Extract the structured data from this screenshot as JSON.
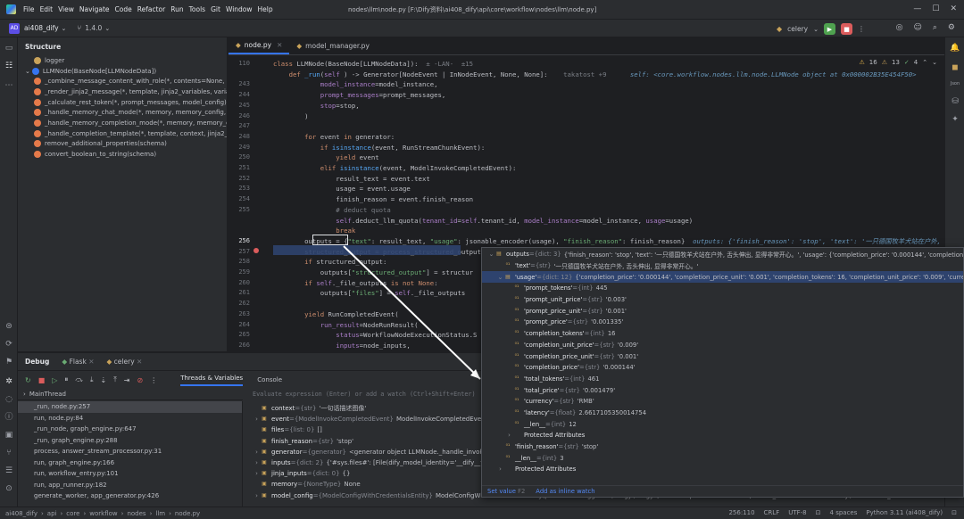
{
  "titlebar": {
    "menu": [
      "File",
      "Edit",
      "View",
      "Navigate",
      "Code",
      "Refactor",
      "Run",
      "Tools",
      "Git",
      "Window",
      "Help"
    ],
    "path": "nodes\\llm\\node.py [F:\\Dify资料\\ai408_dify\\api\\core\\workflow\\nodes\\llm\\node.py]"
  },
  "toolbar": {
    "project_badge": "AD",
    "project": "ai408_dify",
    "branch": "1.4.0",
    "run_config": "celery"
  },
  "structure": {
    "title": "Structure",
    "items": [
      {
        "label": "logger",
        "color": "#c9a35a",
        "indent": 1
      },
      {
        "label": "LLMNode(BaseNode[LLMNodeData])",
        "color": "#3574f0",
        "indent": 0
      },
      {
        "label": "_combine_message_content_with_role(*, contents=None, role)",
        "color": "#e57a4a",
        "indent": 1
      },
      {
        "label": "_render_jinja2_message(*, template, jinja2_variables, variable_pool)",
        "color": "#e57a4a",
        "indent": 1
      },
      {
        "label": "_calculate_rest_token(*, prompt_messages, model_config)",
        "color": "#e57a4a",
        "indent": 1
      },
      {
        "label": "_handle_memory_chat_mode(*, memory, memory_config, model_con",
        "color": "#e57a4a",
        "indent": 1
      },
      {
        "label": "_handle_memory_completion_mode(*, memory, memory_config, mo",
        "color": "#e57a4a",
        "indent": 1
      },
      {
        "label": "_handle_completion_template(*, template, context, jinja2_variables, v",
        "color": "#e57a4a",
        "indent": 1
      },
      {
        "label": "remove_additional_properties(schema)",
        "color": "#e57a4a",
        "indent": 1
      },
      {
        "label": "convert_boolean_to_string(schema)",
        "color": "#e57a4a",
        "indent": 1
      }
    ]
  },
  "editor": {
    "tabs": [
      "node.py",
      "model_manager.py"
    ],
    "inspection": {
      "warnings": "16",
      "weak": "13",
      "typos": "4"
    },
    "lines": [
      {
        "n": "110",
        "parts": [
          [
            "kw",
            "class "
          ],
          [
            "",
            "LLMNode(BaseNode[LLMNodeData]):  "
          ],
          [
            "cm",
            "± -LAN-  ±15"
          ]
        ]
      },
      {
        "n": "",
        "parts": [
          [
            "kw",
            "    def "
          ],
          [
            "fn",
            "_run"
          ],
          [
            "",
            "("
          ],
          [
            "param",
            "self"
          ],
          [
            "",
            " ) -> Generator["
          ],
          [
            "",
            "NodeEvent | InNodeEvent, None, None]:  "
          ],
          [
            "cm",
            "  takatost +9      "
          ],
          [
            "dbg",
            "self: <core.workflow.nodes.llm.node.LLMNode object at 0x000002B35E454F50>"
          ]
        ]
      },
      {
        "n": "243",
        "parts": [
          [
            "",
            "            "
          ],
          [
            "param",
            "model_instance"
          ],
          [
            "",
            "=model_instance,"
          ]
        ]
      },
      {
        "n": "244",
        "parts": [
          [
            "",
            "            "
          ],
          [
            "param",
            "prompt_messages"
          ],
          [
            "",
            "=prompt_messages,"
          ]
        ]
      },
      {
        "n": "245",
        "parts": [
          [
            "",
            "            "
          ],
          [
            "param",
            "stop"
          ],
          [
            "",
            "=stop,"
          ]
        ]
      },
      {
        "n": "246",
        "parts": [
          [
            "",
            "        )"
          ]
        ]
      },
      {
        "n": "247",
        "parts": [
          [
            "",
            ""
          ]
        ]
      },
      {
        "n": "248",
        "parts": [
          [
            "kw",
            "        for "
          ],
          [
            "",
            "event "
          ],
          [
            "kw",
            "in "
          ],
          [
            "",
            "generator:"
          ]
        ]
      },
      {
        "n": "249",
        "parts": [
          [
            "kw",
            "            if "
          ],
          [
            "fn",
            "isinstance"
          ],
          [
            "",
            "(event, RunStreamChunkEvent):"
          ]
        ]
      },
      {
        "n": "250",
        "parts": [
          [
            "kw",
            "                yield "
          ],
          [
            "",
            "event"
          ]
        ]
      },
      {
        "n": "251",
        "parts": [
          [
            "kw",
            "            elif "
          ],
          [
            "fn",
            "isinstance"
          ],
          [
            "",
            "(event, ModelInvokeCompletedEvent):"
          ]
        ]
      },
      {
        "n": "252",
        "parts": [
          [
            "",
            "                result_text = event.text"
          ]
        ]
      },
      {
        "n": "253",
        "parts": [
          [
            "",
            "                usage = event.usage"
          ]
        ]
      },
      {
        "n": "254",
        "parts": [
          [
            "",
            "                finish_reason = event.finish_reason"
          ]
        ]
      },
      {
        "n": "255",
        "parts": [
          [
            "cm",
            "                # deduct quota"
          ]
        ]
      },
      {
        "n": "",
        "parts": [
          [
            "",
            "                "
          ],
          [
            "param",
            "self"
          ],
          [
            "",
            ".deduct_llm_quota("
          ],
          [
            "param",
            "tenant_id"
          ],
          [
            "",
            "="
          ],
          [
            "param",
            "self"
          ],
          [
            "",
            ".tenant_id, "
          ],
          [
            "param",
            "model_instance"
          ],
          [
            "",
            "=model_instance, "
          ],
          [
            "param",
            "usage"
          ],
          [
            "",
            "=usage)"
          ]
        ]
      },
      {
        "n": "",
        "parts": [
          [
            "kw",
            "                break"
          ]
        ]
      },
      {
        "n": "256",
        "parts": [
          [
            "",
            "        outputs = {"
          ],
          [
            "str",
            "\"text\""
          ],
          [
            "",
            ": result_text, "
          ],
          [
            "str",
            "\"usage\""
          ],
          [
            "",
            ": jsonable_encoder(usage), "
          ],
          [
            "str",
            "\"finish_reason\""
          ],
          [
            "",
            ": finish_reason}  "
          ],
          [
            "dbg",
            "outputs: {'finish_reason': 'stop', 'text': '一只德国牧羊犬站在户外, 舌头"
          ]
        ]
      },
      {
        "n": "257",
        "parts": [
          [
            "",
            "        structured_output = process_structured_output"
          ]
        ]
      },
      {
        "n": "258",
        "parts": [
          [
            "kw",
            "        if "
          ],
          [
            "",
            "structured_output:"
          ]
        ]
      },
      {
        "n": "259",
        "parts": [
          [
            "",
            "            outputs["
          ],
          [
            "str",
            "\"structured_output\""
          ],
          [
            "",
            "] = structur"
          ]
        ]
      },
      {
        "n": "260",
        "parts": [
          [
            "kw",
            "        if "
          ],
          [
            "param",
            "self"
          ],
          [
            "",
            "._file_outputs "
          ],
          [
            "kw",
            "is not "
          ],
          [
            "kw",
            "None"
          ],
          [
            "",
            ":"
          ]
        ]
      },
      {
        "n": "261",
        "parts": [
          [
            "",
            "            outputs["
          ],
          [
            "str",
            "\"files\""
          ],
          [
            "",
            "] = "
          ],
          [
            "param",
            "self"
          ],
          [
            "",
            "._file_outputs"
          ]
        ]
      },
      {
        "n": "262",
        "parts": [
          [
            "",
            ""
          ]
        ]
      },
      {
        "n": "263",
        "parts": [
          [
            "kw",
            "        yield "
          ],
          [
            "",
            "RunCompletedEvent("
          ]
        ]
      },
      {
        "n": "264",
        "parts": [
          [
            "",
            "            "
          ],
          [
            "param",
            "run_result"
          ],
          [
            "",
            "=NodeRunResult("
          ]
        ]
      },
      {
        "n": "265",
        "parts": [
          [
            "",
            "                "
          ],
          [
            "param",
            "status"
          ],
          [
            "",
            "=WorkflowNodeExecutionStatus.S"
          ]
        ]
      },
      {
        "n": "266",
        "parts": [
          [
            "",
            "                "
          ],
          [
            "param",
            "inputs"
          ],
          [
            "",
            "=node_inputs,"
          ]
        ]
      }
    ]
  },
  "debug": {
    "tabs": [
      "Debug",
      "Flask",
      "celery"
    ],
    "subtabs": [
      "Threads & Variables",
      "Console"
    ],
    "thread": "MainThread",
    "evaluate_placeholder": "Evaluate expression (Enter) or add a watch (Ctrl+Shift+Enter)",
    "frames": [
      "_run, node.py:257",
      "run, node.py:84",
      "_run_node, graph_engine.py:647",
      "_run, graph_engine.py:288",
      "process, answer_stream_processor.py:31",
      "run, graph_engine.py:166",
      "run, workflow_entry.py:101",
      "run, app_runner.py:182",
      "generate_worker, app_generator.py:426"
    ],
    "variables": [
      {
        "name": "context",
        "type": "{str}",
        "value": "'一句话描述图像'"
      },
      {
        "name": "event",
        "type": "{ModelInvokeCompletedEvent}",
        "value": "ModelInvokeCompletedEvent(tex"
      },
      {
        "name": "files",
        "type": "{list: 0}",
        "value": "[]"
      },
      {
        "name": "finish_reason",
        "type": "{str}",
        "value": "'stop'"
      },
      {
        "name": "generator",
        "type": "{generator}",
        "value": "<generator object LLMNode._handle_invoke_resu"
      },
      {
        "name": "inputs",
        "type": "{dict: 2}",
        "value": "{'#sys.files#': [File(dify_model_identity='__dify__file__', id="
      },
      {
        "name": "jinja_inputs",
        "type": "{dict: 0}",
        "value": "{}"
      },
      {
        "name": "memory",
        "type": "{NoneType}",
        "value": "None"
      },
      {
        "name": "model_config",
        "type": "{ModelConfigWithCredentialsEntity}",
        "value": "ModelConfigWithCredentialsEntity(provider='langgenius/tongyi/tongyi', model='qwen-vl-max-latest', model_schema=AIModelEntity(m... started_at=100225.0793741), credentials={'... View"
      }
    ]
  },
  "popup": {
    "rows": [
      {
        "indent": 0,
        "tw": "⌄",
        "name": "outputs",
        "type": "{dict: 3}",
        "value": "{'finish_reason': 'stop', 'text': '一只德国牧羊犬站在户外, 舌头伸出, 显得非常开心。', 'usage': {'completion_price': '0.000144', 'completion_price_u... View",
        "sel": false
      },
      {
        "indent": 1,
        "tw": "",
        "name": "'text'",
        "type": "{str}",
        "value": "'一只德国牧羊犬站在户外, 舌头伸出, 显得非常开心。'",
        "sel": false
      },
      {
        "indent": 1,
        "tw": "⌄",
        "name": "'usage'",
        "type": "{dict: 12}",
        "value": "{'completion_price': '0.000144', 'completion_price_unit': '0.001', 'completion_tokens': 16, 'completion_unit_price': '0.009', 'currency': 'RMI... View",
        "sel": true
      },
      {
        "indent": 2,
        "tw": "",
        "name": "'prompt_tokens'",
        "type": "{int}",
        "value": "445",
        "sel": false
      },
      {
        "indent": 2,
        "tw": "",
        "name": "'prompt_unit_price'",
        "type": "{str}",
        "value": "'0.003'",
        "sel": false
      },
      {
        "indent": 2,
        "tw": "",
        "name": "'prompt_price_unit'",
        "type": "{str}",
        "value": "'0.001'",
        "sel": false
      },
      {
        "indent": 2,
        "tw": "",
        "name": "'prompt_price'",
        "type": "{str}",
        "value": "'0.001335'",
        "sel": false
      },
      {
        "indent": 2,
        "tw": "",
        "name": "'completion_tokens'",
        "type": "{int}",
        "value": "16",
        "sel": false
      },
      {
        "indent": 2,
        "tw": "",
        "name": "'completion_unit_price'",
        "type": "{str}",
        "value": "'0.009'",
        "sel": false
      },
      {
        "indent": 2,
        "tw": "",
        "name": "'completion_price_unit'",
        "type": "{str}",
        "value": "'0.001'",
        "sel": false
      },
      {
        "indent": 2,
        "tw": "",
        "name": "'completion_price'",
        "type": "{str}",
        "value": "'0.000144'",
        "sel": false
      },
      {
        "indent": 2,
        "tw": "",
        "name": "'total_tokens'",
        "type": "{int}",
        "value": "461",
        "sel": false
      },
      {
        "indent": 2,
        "tw": "",
        "name": "'total_price'",
        "type": "{str}",
        "value": "'0.001479'",
        "sel": false
      },
      {
        "indent": 2,
        "tw": "",
        "name": "'currency'",
        "type": "{str}",
        "value": "'RMB'",
        "sel": false
      },
      {
        "indent": 2,
        "tw": "",
        "name": "'latency'",
        "type": "{float}",
        "value": "2.6617105350014754",
        "sel": false
      },
      {
        "indent": 2,
        "tw": "",
        "name": "__len__",
        "type": "{int}",
        "value": "12",
        "sel": false
      },
      {
        "indent": 2,
        "tw": "›",
        "name": "Protected Attributes",
        "type": "",
        "value": "",
        "sel": false
      },
      {
        "indent": 1,
        "tw": "",
        "name": "'finish_reason'",
        "type": "{str}",
        "value": "'stop'",
        "sel": false
      },
      {
        "indent": 1,
        "tw": "",
        "name": "__len__",
        "type": "{int}",
        "value": "3",
        "sel": false
      },
      {
        "indent": 1,
        "tw": "›",
        "name": "Protected Attributes",
        "type": "",
        "value": "",
        "sel": false
      }
    ],
    "footer": {
      "set_value": "Set value",
      "set_value_key": "F2",
      "add_inline": "Add as inline watch"
    }
  },
  "statusbar": {
    "breadcrumb": [
      "ai408_dify",
      "api",
      "core",
      "workflow",
      "nodes",
      "llm",
      "node.py"
    ],
    "position": "256:110",
    "line_ending": "CRLF",
    "encoding": "UTF-8",
    "indent": "4 spaces",
    "interpreter": "Python 3.11 (ai408_dify)"
  },
  "colors": {
    "accent": "#3574f0",
    "selection": "#2e436e",
    "bg": "#1e1f22",
    "panel": "#2b2d30"
  }
}
